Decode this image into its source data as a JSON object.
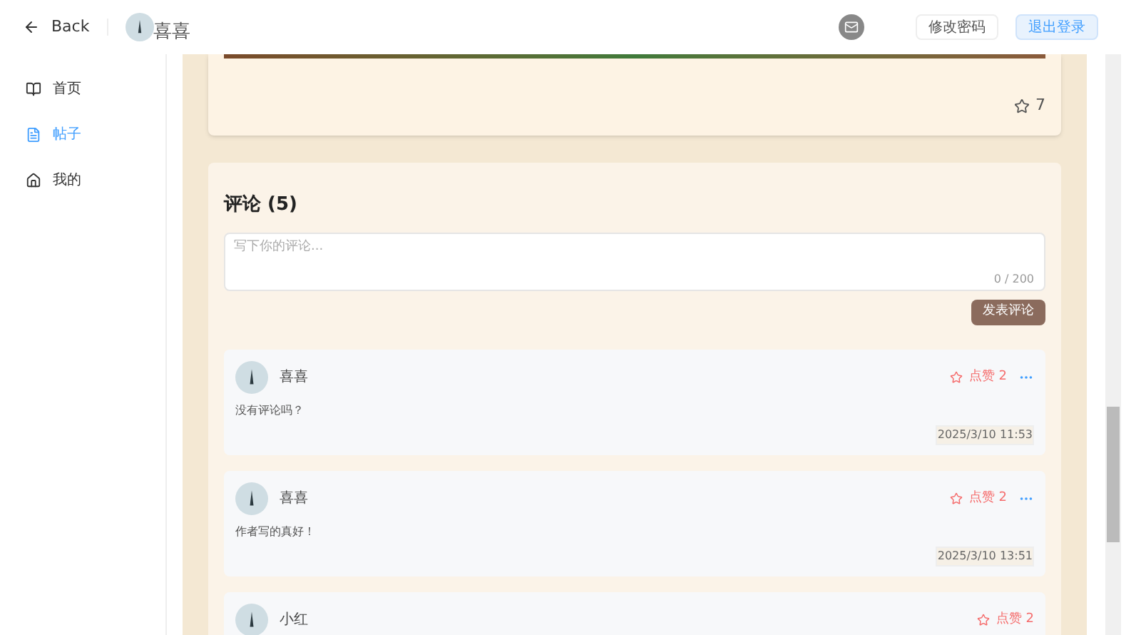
{
  "header": {
    "back": "Back",
    "user_name": "喜喜",
    "buttons": [
      {
        "label": "修改密码",
        "kind": "plain"
      },
      {
        "label": "退出登录",
        "kind": "primary"
      }
    ]
  },
  "sidebar": {
    "items": [
      {
        "label": "首页",
        "kind": "book",
        "selected": false
      },
      {
        "label": "帖子",
        "kind": "document",
        "selected": true
      },
      {
        "label": "我的",
        "kind": "home",
        "selected": false
      }
    ]
  },
  "post": {
    "stars": "7"
  },
  "comments_section": {
    "title": "评论 (5)",
    "placeholder": "写下你的评论...",
    "counter": "0 / 200",
    "submit": "发表评论",
    "comments": [
      {
        "author": "喜喜",
        "likes": "点赞 2",
        "has_menu": true,
        "text": "没有评论吗？",
        "time": "2025/3/10 11:53"
      },
      {
        "author": "喜喜",
        "likes": "点赞 2",
        "has_menu": true,
        "text": "作者写的真好！",
        "time": "2025/3/10 13:51"
      },
      {
        "author": "小红",
        "likes": "点赞 2",
        "has_menu": false
      }
    ]
  }
}
